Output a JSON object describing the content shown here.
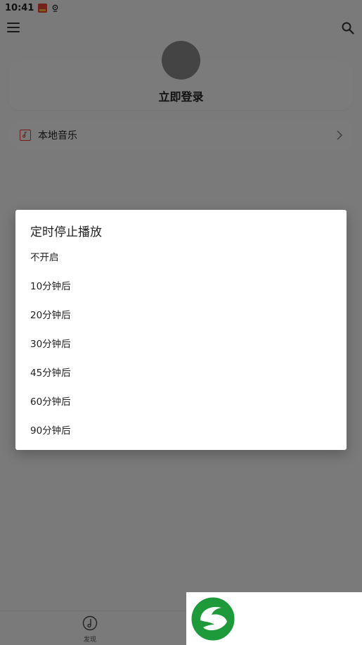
{
  "status_bar": {
    "time": "10:41"
  },
  "profile": {
    "login_label": "立即登录"
  },
  "local_music": {
    "label": "本地音乐"
  },
  "bottom_nav": {
    "discover_label": "发现"
  },
  "dialog": {
    "title": "定时停止播放",
    "options": [
      {
        "label": "不开启"
      },
      {
        "label": "10分钟后"
      },
      {
        "label": "20分钟后"
      },
      {
        "label": "30分钟后"
      },
      {
        "label": "45分钟后"
      },
      {
        "label": "60分钟后"
      },
      {
        "label": "90分钟后"
      }
    ]
  },
  "colors": {
    "scrim": "rgba(0,0,0,0.5)",
    "accent_red": "#e33333",
    "logo_green": "#1f9a3a"
  },
  "icons": {
    "menu": "menu-icon",
    "search": "search-icon",
    "local_music": "music-box-icon",
    "chevron": "chevron-right-icon",
    "discover": "music-note-icon",
    "logo": "leaf-logo-icon"
  }
}
